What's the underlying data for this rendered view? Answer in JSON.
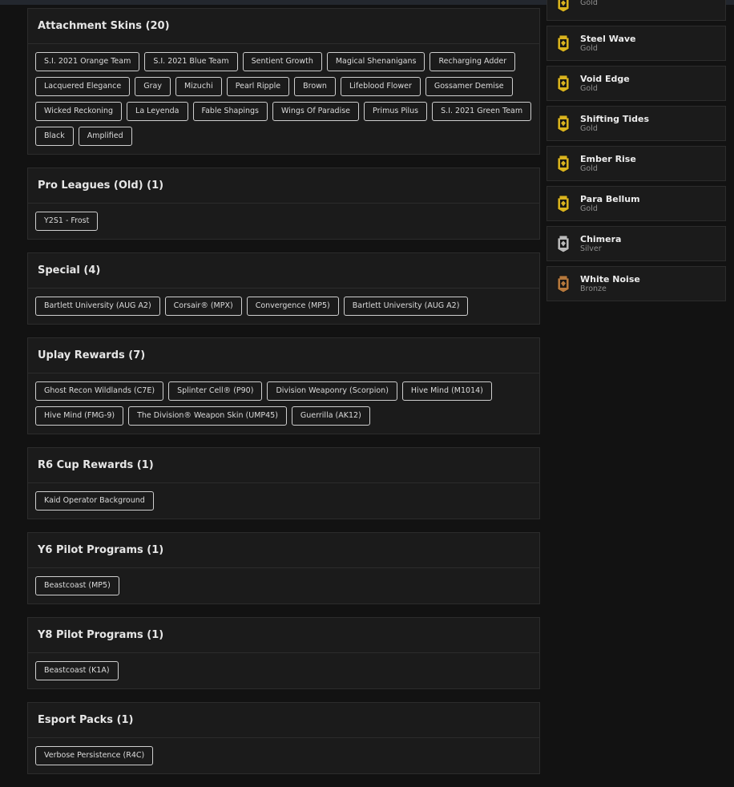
{
  "sections": [
    {
      "title": "Attachment Skins (20)",
      "items": [
        "S.I. 2021 Orange Team",
        "S.I. 2021 Blue Team",
        "Sentient Growth",
        "Magical Shenanigans",
        "Recharging Adder",
        "Lacquered Elegance",
        "Gray",
        "Mizuchi",
        "Pearl Ripple",
        "Brown",
        "Lifeblood Flower",
        "Gossamer Demise",
        "Wicked Reckoning",
        "La Leyenda",
        "Fable Shapings",
        "Wings Of Paradise",
        "Primus Pilus",
        "S.I. 2021 Green Team",
        "Black",
        "Amplified"
      ]
    },
    {
      "title": "Pro Leagues (Old) (1)",
      "items": [
        "Y2S1 - Frost"
      ]
    },
    {
      "title": "Special (4)",
      "items": [
        "Bartlett University (AUG A2)",
        "Corsair® (MPX)",
        "Convergence (MP5)",
        "Bartlett University (AUG A2)"
      ]
    },
    {
      "title": "Uplay Rewards (7)",
      "items": [
        "Ghost Recon Wildlands (C7E)",
        "Splinter Cell® (P90)",
        "Division Weaponry (Scorpion)",
        "Hive Mind (M1014)",
        "Hive Mind (FMG-9)",
        "The Division® Weapon Skin (UMP45)",
        "Guerrilla (AK12)"
      ]
    },
    {
      "title": "R6 Cup Rewards (1)",
      "items": [
        "Kaid Operator Background"
      ]
    },
    {
      "title": "Y6 Pilot Programs (1)",
      "items": [
        "Beastcoast (MP5)"
      ]
    },
    {
      "title": "Y8 Pilot Programs (1)",
      "items": [
        "Beastcoast (K1A)"
      ]
    },
    {
      "title": "Esport Packs (1)",
      "items": [
        "Verbose Persistence (R4C)"
      ]
    }
  ],
  "charms": [
    {
      "name": "",
      "tier": "Gold",
      "icon": "gold-charm-icon",
      "color": "#d8b21e"
    },
    {
      "name": "Steel Wave",
      "tier": "Gold",
      "icon": "gold-charm-icon",
      "color": "#d8b21e"
    },
    {
      "name": "Void Edge",
      "tier": "Gold",
      "icon": "gold-charm-icon",
      "color": "#d8b21e"
    },
    {
      "name": "Shifting Tides",
      "tier": "Gold",
      "icon": "gold-charm-icon",
      "color": "#d8b21e"
    },
    {
      "name": "Ember Rise",
      "tier": "Gold",
      "icon": "gold-charm-icon",
      "color": "#d8b21e"
    },
    {
      "name": "Para Bellum",
      "tier": "Gold",
      "icon": "gold-charm-icon",
      "color": "#d8b21e"
    },
    {
      "name": "Chimera",
      "tier": "Silver",
      "icon": "silver-charm-icon",
      "color": "#b9b9b9"
    },
    {
      "name": "White Noise",
      "tier": "Bronze",
      "icon": "bronze-charm-icon",
      "color": "#b5783c"
    }
  ]
}
